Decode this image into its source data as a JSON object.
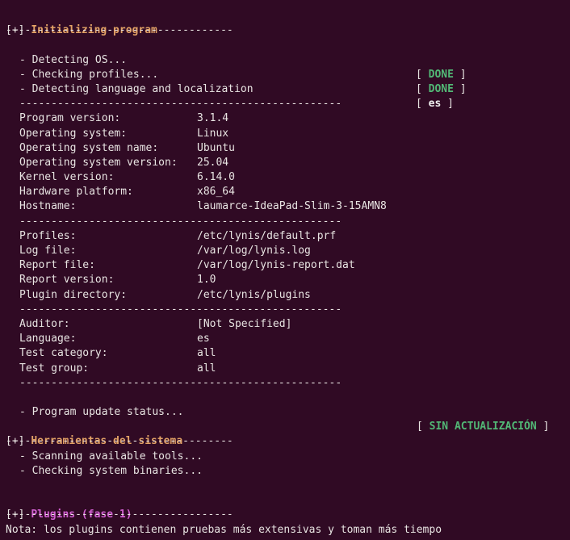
{
  "section_init": {
    "open": "[+] ",
    "title": "Initializing program",
    "underline": "------------------------------------"
  },
  "steps": [
    {
      "label": "- Detecting OS...",
      "status": "DONE"
    },
    {
      "label": "- Checking profiles...",
      "status": "DONE"
    },
    {
      "label": "- Detecting language and localization",
      "status": "es"
    }
  ],
  "bracket_open": "[ ",
  "bracket_close": " ]",
  "divider": "---------------------------------------------------",
  "system_info": [
    {
      "key": "Program version:",
      "value": "3.1.4"
    },
    {
      "key": "Operating system:",
      "value": "Linux"
    },
    {
      "key": "Operating system name:",
      "value": "Ubuntu"
    },
    {
      "key": "Operating system version:",
      "value": "25.04"
    },
    {
      "key": "Kernel version:",
      "value": "6.14.0"
    },
    {
      "key": "Hardware platform:",
      "value": "x86_64"
    },
    {
      "key": "Hostname:",
      "value": "laumarce-IdeaPad-Slim-3-15AMN8"
    }
  ],
  "paths_info": [
    {
      "key": "Profiles:",
      "value": "/etc/lynis/default.prf"
    },
    {
      "key": "Log file:",
      "value": "/var/log/lynis.log"
    },
    {
      "key": "Report file:",
      "value": "/var/log/lynis-report.dat"
    },
    {
      "key": "Report version:",
      "value": "1.0"
    },
    {
      "key": "Plugin directory:",
      "value": "/etc/lynis/plugins"
    }
  ],
  "audit_info": [
    {
      "key": "Auditor:",
      "value": "[Not Specified]"
    },
    {
      "key": "Language:",
      "value": "es"
    },
    {
      "key": "Test category:",
      "value": "all"
    },
    {
      "key": "Test group:",
      "value": "all"
    }
  ],
  "update": {
    "label": "- Program update status...",
    "status": "SIN ACTUALIZACIÓN"
  },
  "section_tools": {
    "open": "[+] ",
    "title": "Herramientas del sistema",
    "underline": "------------------------------------"
  },
  "tool_steps": [
    "- Scanning available tools...",
    "- Checking system binaries..."
  ],
  "section_plugins": {
    "open": "[+] ",
    "title": "Plugins (fase 1)",
    "underline": "------------------------------------"
  },
  "note": "Nota: los plugins contienen pruebas más extensivas y toman más tiempo",
  "colors": {
    "background": "#300a24",
    "text": "#e8e4e2",
    "done": "#52b876",
    "section_orange": "#e1a166",
    "section_magenta": "#d160d1"
  }
}
